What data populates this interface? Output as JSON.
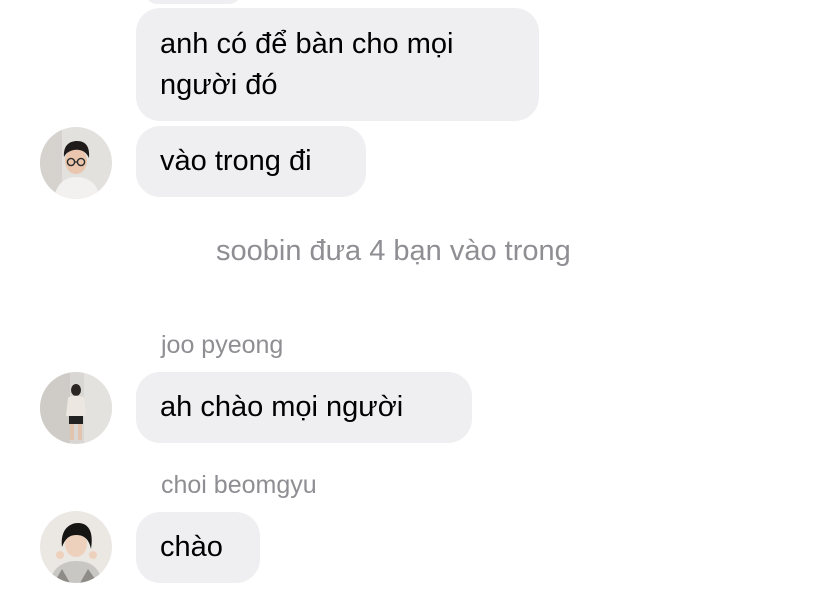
{
  "messages": [
    {
      "text": "anh có để bàn cho mọi\nngười đó"
    },
    {
      "text": "vào trong đi"
    },
    {
      "text": "ah chào mọi người"
    },
    {
      "text": "chào"
    }
  ],
  "system_message": "soobin đưa 4 bạn vào trong",
  "senders": [
    "joo pyeong",
    "choi beomgyu"
  ],
  "colors": {
    "bubble_bg": "#efeff1",
    "meta_text": "#8e8e93",
    "background": "#ffffff"
  },
  "avatars": [
    "avatar-photo-boy-glasses",
    "avatar-photo-girl-full-body",
    "avatar-photo-girl-short-hair"
  ]
}
